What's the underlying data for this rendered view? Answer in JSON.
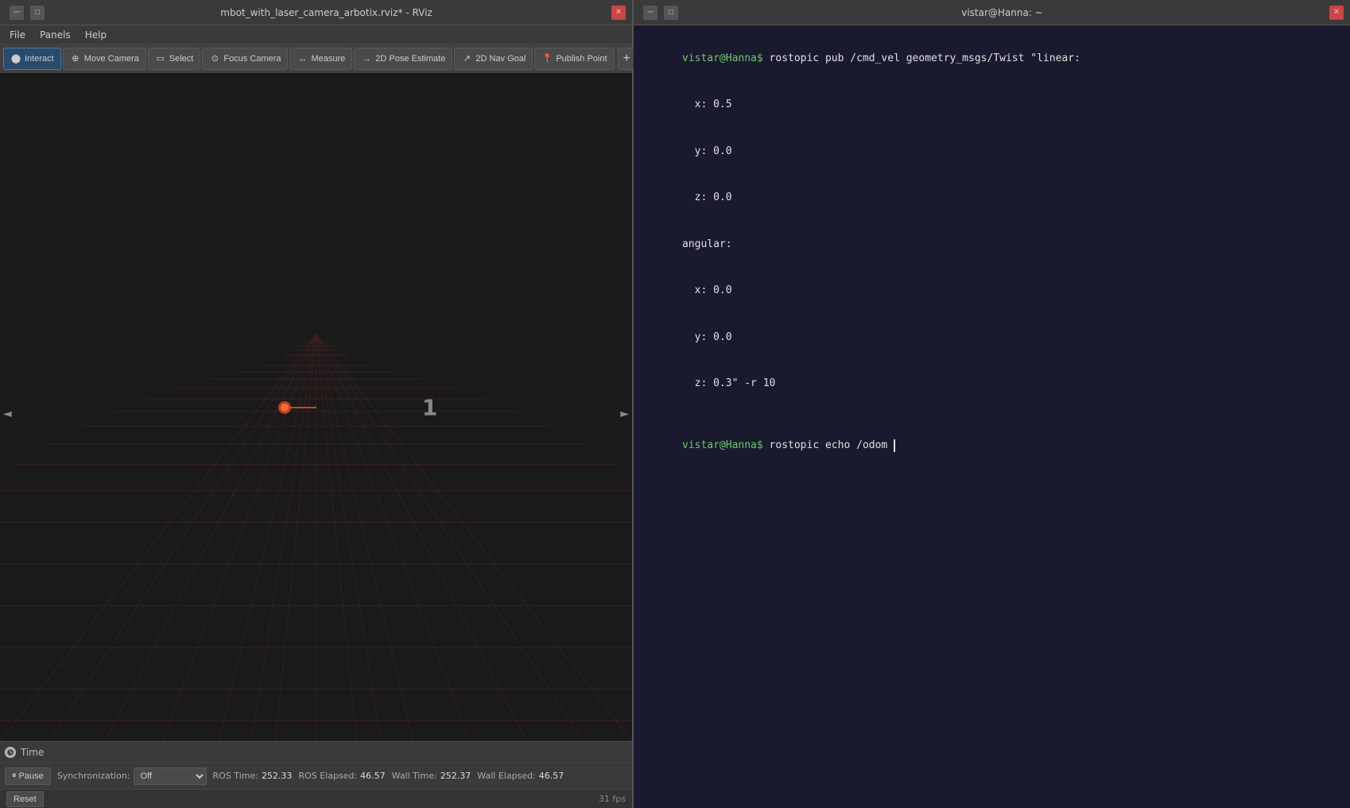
{
  "rviz": {
    "title": "mbot_with_laser_camera_arbotix.rviz* - RViz",
    "menu": {
      "file": "File",
      "panels": "Panels",
      "help": "Help"
    },
    "toolbar": {
      "interact": "Interact",
      "move_camera": "Move Camera",
      "select": "Select",
      "focus_camera": "Focus Camera",
      "measure": "Measure",
      "pose_estimate": "2D Pose Estimate",
      "nav_goal": "2D Nav Goal",
      "publish_point": "Publish Point"
    },
    "viewport_number": "1",
    "time_panel": {
      "label": "Time",
      "close_icon": "×"
    },
    "time_controls": {
      "pause_label": "Pause",
      "sync_label": "Synchronization:",
      "sync_value": "Off",
      "ros_time_label": "ROS Time:",
      "ros_time_value": "252.33",
      "ros_elapsed_label": "ROS Elapsed:",
      "ros_elapsed_value": "46.57",
      "wall_time_label": "Wall Time:",
      "wall_time_value": "252.37",
      "wall_elapsed_label": "Wall Elapsed:",
      "wall_elapsed_value": "46.57"
    },
    "statusbar": {
      "fps": "31 fps",
      "reset": "Reset"
    }
  },
  "terminal": {
    "title": "vistar@Hanna: ~",
    "lines": [
      {
        "type": "command",
        "prompt": "vistar@Hanna$",
        "text": " rostopic pub /cmd_vel geometry_msgs/Twist \"linear:"
      },
      {
        "type": "output",
        "text": "  x: 0.5"
      },
      {
        "type": "output",
        "text": "  y: 0.0"
      },
      {
        "type": "output",
        "text": "  z: 0.0"
      },
      {
        "type": "output",
        "text": "angular:"
      },
      {
        "type": "output",
        "text": "  x: 0.0"
      },
      {
        "type": "output",
        "text": "  y: 0.0"
      },
      {
        "type": "output",
        "text": "  z: 0.3\" -r 10"
      }
    ],
    "current_command": {
      "prompt": "vistar@Hanna$",
      "text": " rostopic echo /odom "
    }
  }
}
